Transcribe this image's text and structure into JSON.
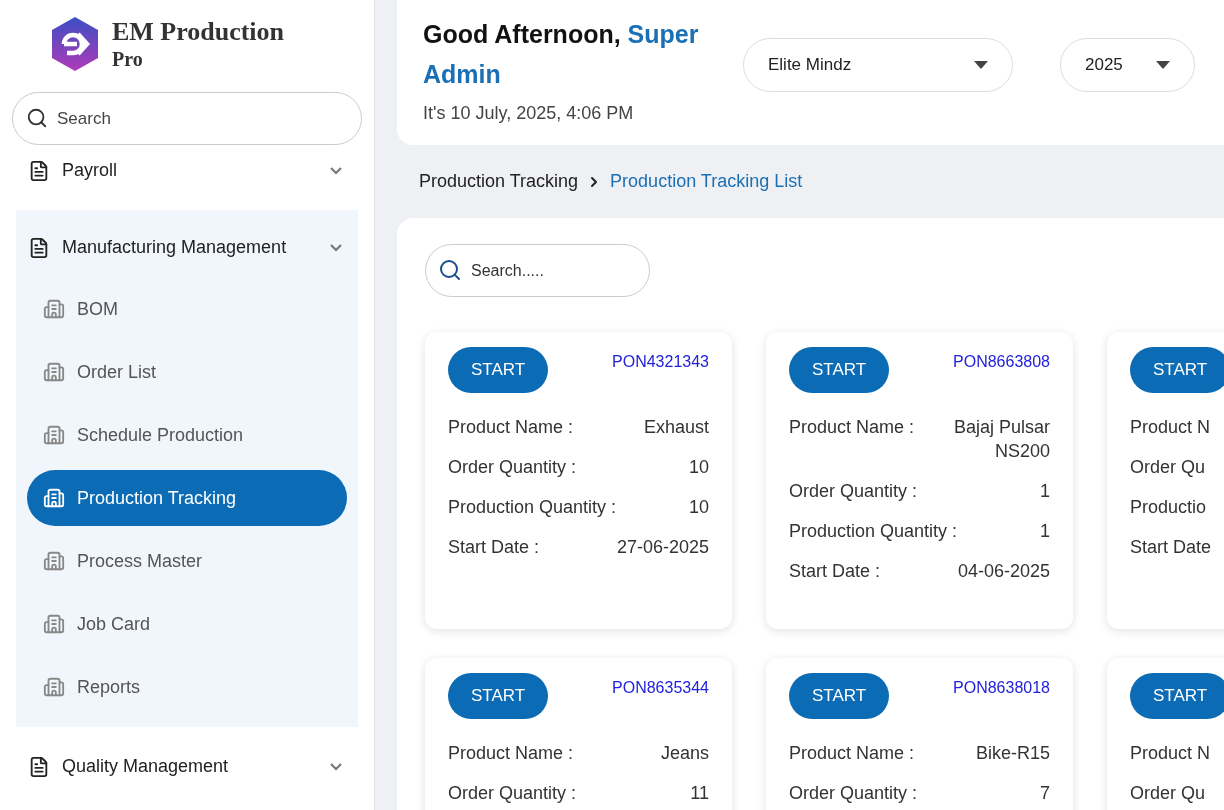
{
  "brand": {
    "name": "EM Production",
    "edition": "Pro"
  },
  "sidebar": {
    "search_placeholder": "Search",
    "items": [
      {
        "label": "Payroll",
        "expanded": false
      },
      {
        "label": "Manufacturing Management",
        "expanded": true,
        "children": [
          {
            "label": "BOM",
            "selected": false
          },
          {
            "label": "Order List",
            "selected": false
          },
          {
            "label": "Schedule Production",
            "selected": false
          },
          {
            "label": "Production Tracking",
            "selected": true
          },
          {
            "label": "Process Master",
            "selected": false
          },
          {
            "label": "Job Card",
            "selected": false
          },
          {
            "label": "Reports",
            "selected": false
          }
        ]
      },
      {
        "label": "Quality Management",
        "expanded": false
      }
    ]
  },
  "header": {
    "greeting": "Good Afternoon,",
    "user_name": "Super Admin",
    "date_line": "It's 10 July, 2025, 4:06 PM"
  },
  "filters": [
    {
      "value": "Elite Mindz"
    },
    {
      "value": "2025"
    }
  ],
  "breadcrumb": [
    {
      "label": "Production Tracking",
      "selected": false
    },
    {
      "label": "Production Tracking List",
      "selected": true
    }
  ],
  "list_search": {
    "placeholder": "Search....."
  },
  "cards": [
    {
      "button": "START",
      "order_no": "PON4321343",
      "fields": [
        {
          "label": "Product Name :",
          "value": "Exhaust"
        },
        {
          "label": "Order Quantity :",
          "value": "10"
        },
        {
          "label": "Production Quantity :",
          "value": "10"
        },
        {
          "label": "Start Date :",
          "value": "27-06-2025"
        }
      ]
    },
    {
      "button": "START",
      "order_no": "PON8663808",
      "fields": [
        {
          "label": "Product Name :",
          "value": "Bajaj Pulsar NS200"
        },
        {
          "label": "Order Quantity :",
          "value": "1"
        },
        {
          "label": "Production Quantity :",
          "value": "1"
        },
        {
          "label": "Start Date :",
          "value": "04-06-2025"
        }
      ]
    },
    {
      "button": "START",
      "fields": [
        {
          "label": "Product N"
        },
        {
          "label": "Order Qu"
        },
        {
          "label": "Productio"
        },
        {
          "label": "Start Date"
        }
      ]
    },
    {
      "button": "START",
      "order_no": "PON8635344",
      "fields": [
        {
          "label": "Product Name :",
          "value": "Jeans"
        },
        {
          "label": "Order Quantity :",
          "value": "11"
        }
      ]
    },
    {
      "button": "START",
      "order_no": "PON8638018",
      "fields": [
        {
          "label": "Product Name :",
          "value": "Bike-R15"
        },
        {
          "label": "Order Quantity :",
          "value": "7"
        }
      ]
    },
    {
      "button": "START",
      "fields": [
        {
          "label": "Product N"
        },
        {
          "label": "Order Qu"
        }
      ]
    }
  ]
}
